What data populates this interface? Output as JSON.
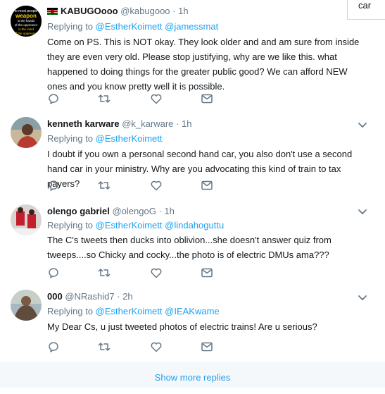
{
  "search": {
    "value": "car"
  },
  "tweets": [
    {
      "author_name": "KABUGOooo",
      "handle": "@kabugooo",
      "time": "1h",
      "replying_label": "Replying to",
      "mentions": [
        "@EstherKoimett",
        "@jamessmat"
      ],
      "text": "Come on PS. This is NOT okay. They look older and and am sure from inside they are even very old. Please stop justifying, why are we like this. what happened to doing things for the greater public good? We can afford NEW ones and you know pretty well it is possible.",
      "avatar_text": [
        "to most people",
        "weapon",
        "is the hands",
        "of the oppressor",
        "is the mind",
        "of the oppressed"
      ]
    },
    {
      "author_name": "kenneth karware",
      "handle": "@k_karware",
      "time": "1h",
      "replying_label": "Replying to",
      "mentions": [
        "@EstherKoimett"
      ],
      "text": "I doubt if you own a personal second hand car, you also don't use a second hand car in your ministry. Why are you advocating this kind of train to tax payers?"
    },
    {
      "author_name": "olengo gabriel",
      "handle": "@olengoG",
      "time": "1h",
      "replying_label": "Replying to",
      "mentions": [
        "@EstherKoimett",
        "@lindahoguttu"
      ],
      "text": "The C's tweets then ducks into oblivion...she doesn't answer quiz from tweeps....so Chicky and cocky...the photo is of electric DMUs ama???"
    },
    {
      "author_name": "000",
      "handle": "@NRashid7",
      "time": "2h",
      "replying_label": "Replying to",
      "mentions": [
        "@EstherKoimett",
        "@IEAKwame"
      ],
      "text": "My Dear Cs, u just tweeted photos of electric trains! Are u serious?"
    }
  ],
  "show_more_label": "Show more replies",
  "separator": "·",
  "icons": [
    "reply-icon",
    "retweet-icon",
    "like-icon",
    "message-icon",
    "chevron-down-icon",
    "kenya-flag-icon"
  ],
  "colors": {
    "link": "#1da1f2",
    "muted": "#657786",
    "text": "#14171a"
  }
}
